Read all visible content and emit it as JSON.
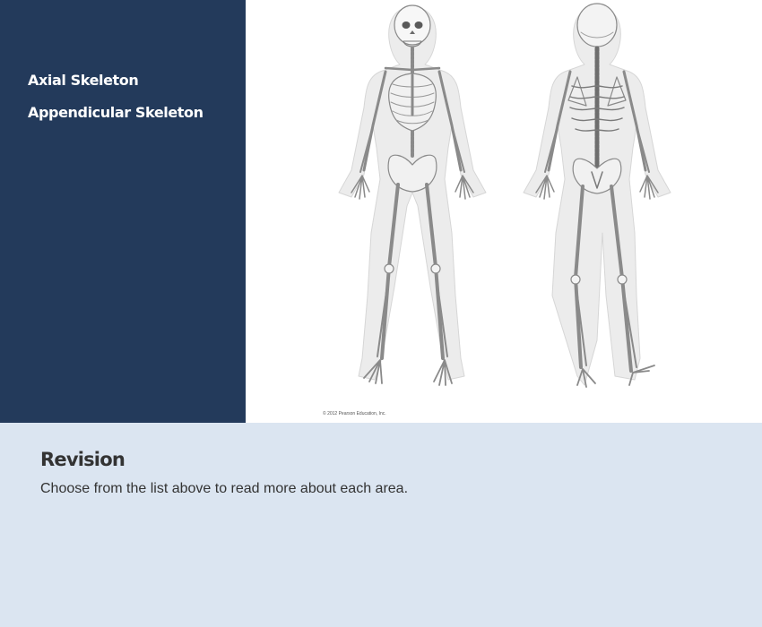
{
  "sidebar": {
    "items": [
      {
        "label": "Axial Skeleton"
      },
      {
        "label": "Appendicular Skeleton"
      }
    ],
    "background": "#233a5b"
  },
  "figure": {
    "credit": "© 2012 Pearson Education, Inc.",
    "views": [
      "anterior-skeleton",
      "posterior-skeleton"
    ]
  },
  "revision": {
    "title": "Revision",
    "text": "Choose from the list above to read more about each area.",
    "background": "#dbe5f1"
  }
}
